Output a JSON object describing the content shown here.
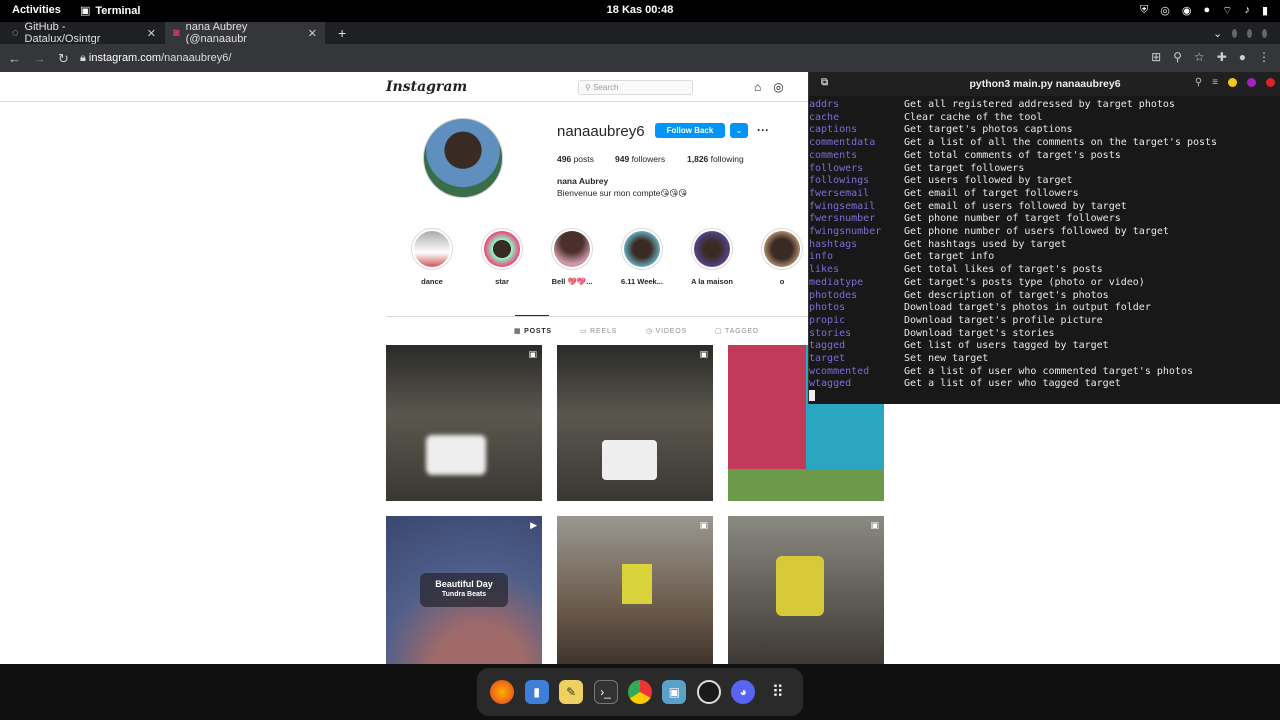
{
  "system": {
    "activities": "Activities",
    "app": "Terminal",
    "clock": "18 Kas  00:48"
  },
  "browser": {
    "tabs": [
      {
        "label": "GitHub - Datalux/Osintgr"
      },
      {
        "label": "nana Aubrey (@nanaaubr"
      }
    ],
    "url_host": "instagram.com",
    "url_path": "/nanaaubrey6/"
  },
  "instagram": {
    "logo": "Instagram",
    "search_placeholder": "Search",
    "username": "nanaaubrey6",
    "follow_label": "Follow Back",
    "more": "···",
    "posts_count": "496",
    "posts_word": "posts",
    "followers_count": "949",
    "followers_word": "followers",
    "following_count": "1,826",
    "following_word": "following",
    "full_name": "nana Aubrey",
    "bio": "Bienvenue sur mon compte😘😘😘",
    "highlights": [
      "dance",
      "star",
      "Bell 💖💖...",
      "6.11 Week...",
      "A la maison",
      "o"
    ],
    "tabs": [
      "POSTS",
      "REELS",
      "VIDEOS",
      "TAGGED"
    ],
    "post_overlay_title": "Beautiful Day",
    "post_overlay_sub": "Tundra Beats"
  },
  "terminal": {
    "title": "python3 main.py nanaaubrey6",
    "commands": [
      "addrs",
      "cache",
      "captions",
      "commentdata",
      "comments",
      "followers",
      "followings",
      "fwersemail",
      "fwingsemail",
      "fwersnumber",
      "fwingsnumber",
      "hashtags",
      "info",
      "likes",
      "mediatype",
      "photodes",
      "photos",
      "propic",
      "stories",
      "tagged",
      "target",
      "wcommented",
      "wtagged"
    ],
    "descriptions": [
      "Get all registered addressed by target photos",
      "Clear cache of the tool",
      "Get target's photos captions",
      "Get a list of all the comments on the target's posts",
      "Get total comments of target's posts",
      "Get target followers",
      "Get users followed by target",
      "Get email of target followers",
      "Get email of users followed by target",
      "Get phone number of target followers",
      "Get phone number of users followed by target",
      "Get hashtags used by target",
      "Get target info",
      "Get total likes of target's posts",
      "Get target's posts type (photo or video)",
      "Get description of target's photos",
      "Download target's photos in output folder",
      "Download target's profile picture",
      "Download target's stories",
      "Get list of users tagged by target",
      "Set new target",
      "Get a list of user who commented target's photos",
      "Get a list of user who tagged target"
    ]
  },
  "dock_icons": [
    "firefox-icon",
    "files-icon",
    "text-editor-icon",
    "terminal-icon",
    "chrome-icon",
    "screenshot-icon",
    "obs-icon",
    "discord-icon",
    "app-grid-icon"
  ]
}
